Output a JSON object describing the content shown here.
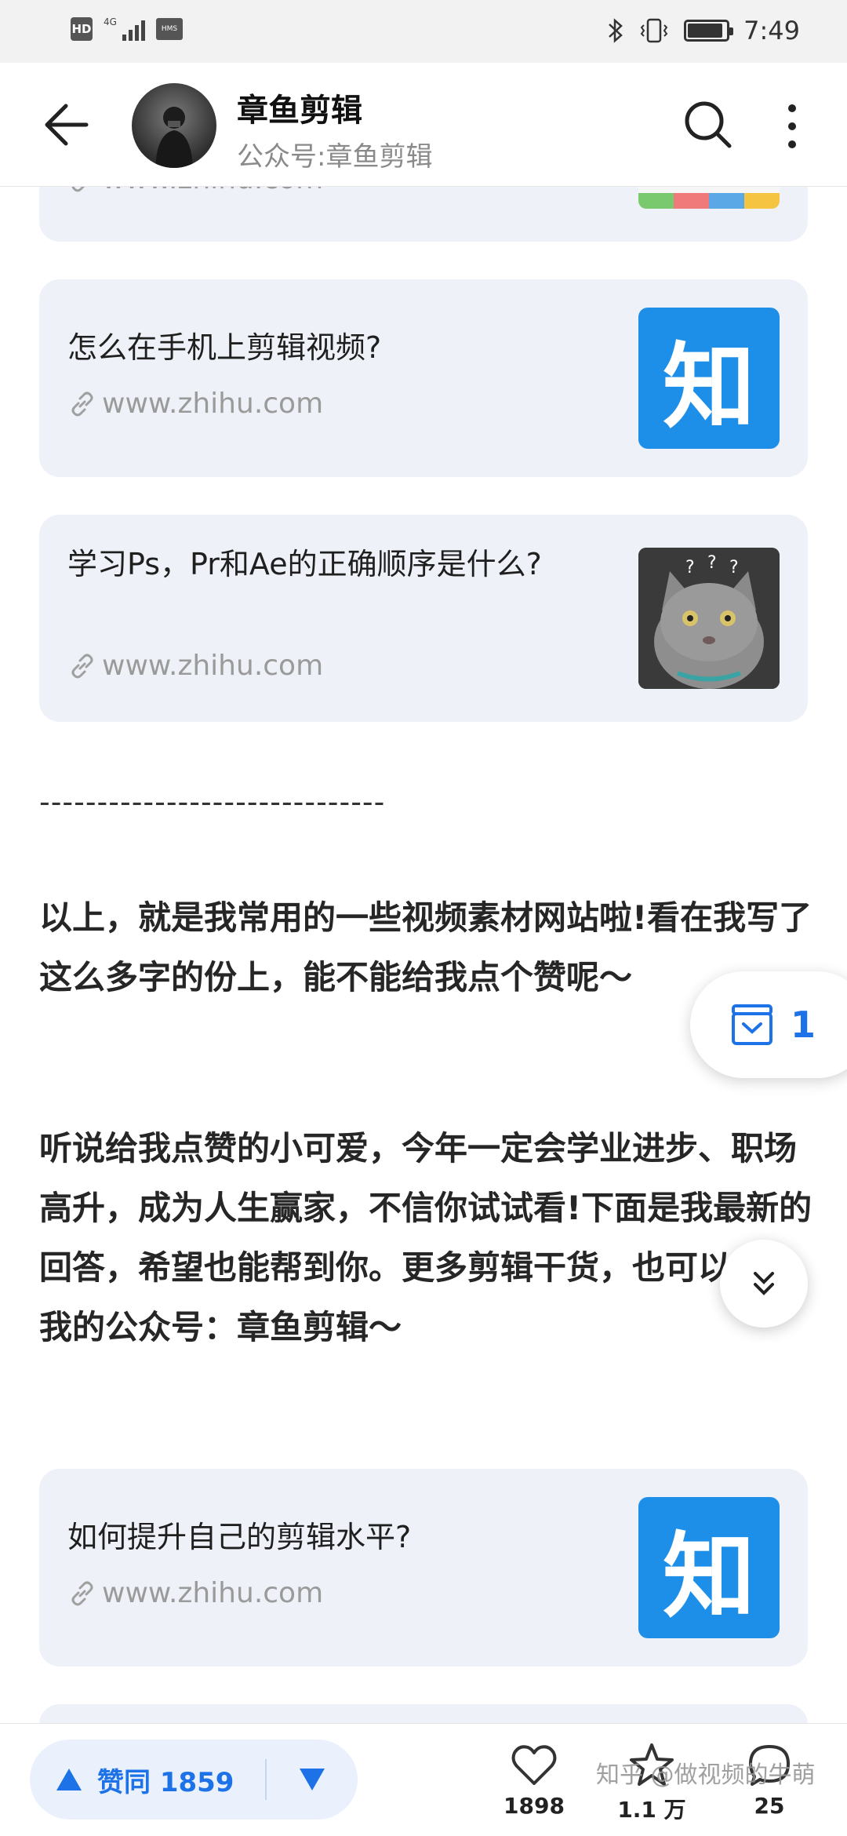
{
  "status_bar": {
    "hd": "HD",
    "signal_label": "4G",
    "hms": "HMS",
    "time": "7:49"
  },
  "header": {
    "title": "章鱼剪辑",
    "subtitle": "公众号:章鱼剪辑"
  },
  "cards": [
    {
      "title": "",
      "link": "www.zhihu.com"
    },
    {
      "title": "怎么在手机上剪辑视频?",
      "link": "www.zhihu.com",
      "thumb": "知"
    },
    {
      "title": "学习Ps，Pr和Ae的正确顺序是什么?",
      "link": "www.zhihu.com"
    },
    {
      "title": "如何提升自己的剪辑水平?",
      "link": "www.zhihu.com",
      "thumb": "知"
    }
  ],
  "article": {
    "divider": "------------------------------",
    "para1": "以上，就是我常用的一些视频素材网站啦!看在我写了这么多字的份上，能不能给我点个赞呢～",
    "para2": "听说给我点赞的小可爱，今年一定会学业进步、职场高升，成为人生赢家，不信你试试看!下面是我最新的回答，希望也能帮到你。更多剪辑干货，也可以关注我的公众号：章鱼剪辑～"
  },
  "float": {
    "favorites_count": "1"
  },
  "bottom_bar": {
    "vote_label": "赞同 1859",
    "like_count": "1898",
    "star_count": "1.1 万",
    "comment_count": "25",
    "watermark": "知乎 @做视频的牛萌"
  },
  "colors": {
    "accent": "#1d72e8",
    "zhihu_blue": "#1d8fe8",
    "card_bg": "#eef1f7"
  }
}
